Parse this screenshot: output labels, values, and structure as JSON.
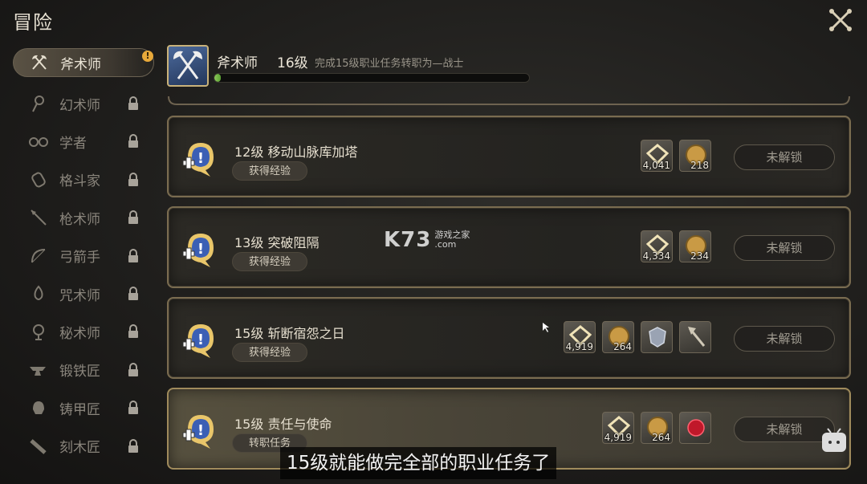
{
  "window": {
    "title": "冒险"
  },
  "sidebar": {
    "items": [
      {
        "label": "斧术师",
        "icon": "axes-icon",
        "active": true,
        "alert": "!"
      },
      {
        "label": "幻术师",
        "icon": "staff-icon",
        "locked": true
      },
      {
        "label": "学者",
        "icon": "glasses-icon",
        "locked": true
      },
      {
        "label": "格斗家",
        "icon": "fist-icon",
        "locked": true
      },
      {
        "label": "枪术师",
        "icon": "spear-icon",
        "locked": true
      },
      {
        "label": "弓箭手",
        "icon": "bow-icon",
        "locked": true
      },
      {
        "label": "咒术师",
        "icon": "flame-icon",
        "locked": true
      },
      {
        "label": "秘术师",
        "icon": "orb-icon",
        "locked": true
      },
      {
        "label": "锻铁匠",
        "icon": "anvil-icon",
        "locked": true
      },
      {
        "label": "铸甲匠",
        "icon": "helmet-icon",
        "locked": true
      },
      {
        "label": "刻木匠",
        "icon": "saw-icon",
        "locked": true
      }
    ]
  },
  "job": {
    "name": "斧术师",
    "level": "16级",
    "description": "完成15级职业任务转职为—战士",
    "progress": 0.02
  },
  "quests": [
    {
      "title": "12级 移动山脉库加塔",
      "button": "获得经验",
      "status": "未解锁",
      "rewards": [
        {
          "icon": "exp-icon",
          "count": "4,041"
        },
        {
          "icon": "gil-coin-icon",
          "count": "218"
        }
      ]
    },
    {
      "title": "13级 突破阻隔",
      "button": "获得经验",
      "status": "未解锁",
      "rewards": [
        {
          "icon": "exp-icon",
          "count": "4,334"
        },
        {
          "icon": "gil-coin-icon",
          "count": "234"
        }
      ]
    },
    {
      "title": "15级 斩断宿怨之日",
      "button": "获得经验",
      "status": "未解锁",
      "rewards": [
        {
          "icon": "exp-icon",
          "count": "4,919"
        },
        {
          "icon": "gil-coin-icon",
          "count": "264"
        },
        {
          "icon": "armor-item-icon",
          "count": ""
        },
        {
          "icon": "axe-item-icon",
          "count": ""
        }
      ]
    },
    {
      "title": "15级 责任与使命",
      "button": "转职任务",
      "status": "未解锁",
      "rewards": [
        {
          "icon": "exp-icon",
          "count": "4,919"
        },
        {
          "icon": "gil-coin-icon",
          "count": "264"
        },
        {
          "icon": "red-gem-icon",
          "count": ""
        }
      ]
    }
  ],
  "watermark": {
    "logo": "K73",
    "line1": "游戏之家",
    "line2": ".com"
  },
  "subtitle": "15级就能做完全部的职业任务了",
  "colors": {
    "accent_gold": "#c9b27a",
    "progress_green": "#7dbf4a",
    "alert": "#e8a93a"
  }
}
